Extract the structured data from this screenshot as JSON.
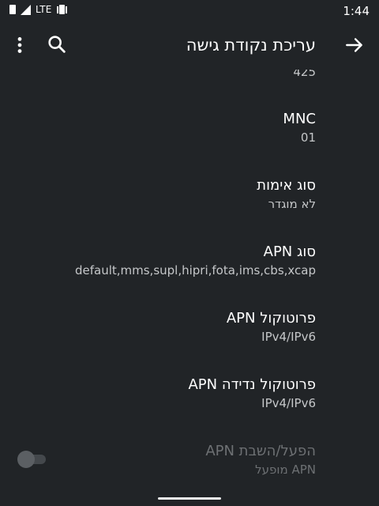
{
  "status_bar": {
    "network": "LTE",
    "time": "1:44"
  },
  "toolbar": {
    "title": "עריכת נקודת גישה",
    "icons": {
      "back": "arrow-right-icon",
      "search": "search-icon",
      "more": "more-vert-icon"
    }
  },
  "list": {
    "partial_value": "425",
    "items": [
      {
        "label": "MNC",
        "value": "01"
      },
      {
        "label": "סוג אימות",
        "value": "לא מוגדר"
      },
      {
        "label": "סוג APN",
        "value": "default,mms,supl,hipri,fota,ims,cbs,xcap"
      },
      {
        "label": "פרוטוקול APN",
        "value": "IPv4/IPv6"
      },
      {
        "label": "פרוטוקול נדידה APN",
        "value": "IPv4/IPv6"
      },
      {
        "label": "הפעל/השבת APN",
        "value": "APN מופעל",
        "disabled": true,
        "toggle_on": false
      }
    ]
  },
  "colors": {
    "background": "#212427",
    "primary_text": "#ffffff",
    "secondary_text": "#c5c7c9",
    "disabled_text": "#6d7073"
  }
}
